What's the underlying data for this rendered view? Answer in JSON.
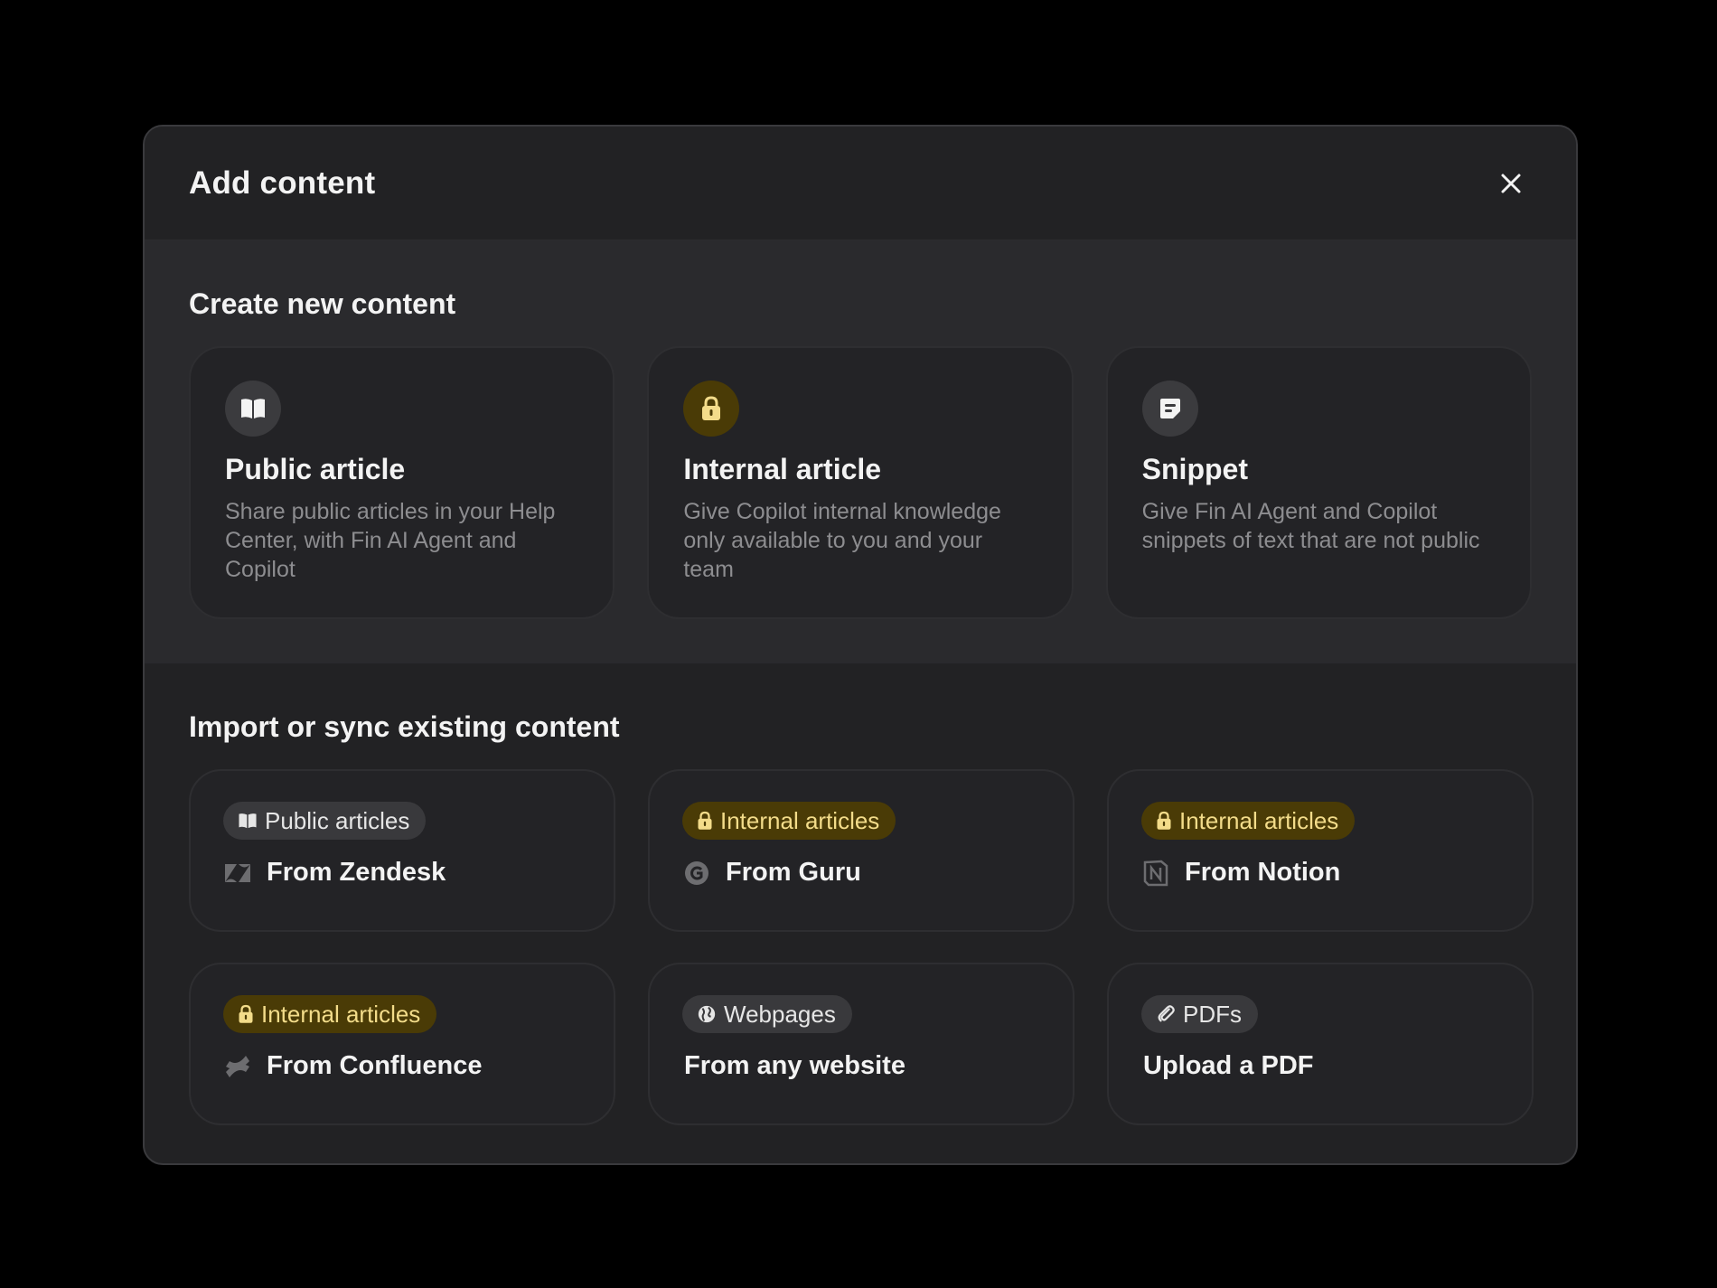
{
  "modal": {
    "title": "Add content",
    "close_icon": "close-icon"
  },
  "create_section": {
    "title": "Create new content",
    "cards": [
      {
        "title": "Public article",
        "description": "Share public articles in your Help Center, with Fin AI Agent and Copilot",
        "icon": "book-icon"
      },
      {
        "title": "Internal article",
        "description": "Give Copilot internal knowledge only available to you and your team",
        "icon": "lock-icon"
      },
      {
        "title": "Snippet",
        "description": "Give Fin AI Agent and Copilot snippets of text that are not public",
        "icon": "snippet-icon"
      }
    ]
  },
  "import_section": {
    "title": "Import or sync existing content",
    "cards": [
      {
        "badge": "Public articles",
        "badge_icon": "book-icon",
        "label": "From Zendesk",
        "source_icon": "zendesk-icon"
      },
      {
        "badge": "Internal articles",
        "badge_icon": "lock-icon",
        "label": "From Guru",
        "source_icon": "guru-icon"
      },
      {
        "badge": "Internal articles",
        "badge_icon": "lock-icon",
        "label": "From Notion",
        "source_icon": "notion-icon"
      },
      {
        "badge": "Internal articles",
        "badge_icon": "lock-icon",
        "label": "From Confluence",
        "source_icon": "confluence-icon"
      },
      {
        "badge": "Webpages",
        "badge_icon": "globe-icon",
        "label": "From any website"
      },
      {
        "badge": "PDFs",
        "badge_icon": "paperclip-icon",
        "label": "Upload a PDF"
      }
    ]
  },
  "colors": {
    "background": "#000000",
    "modal": "#222224",
    "create_section": "#2a2a2d",
    "gold_badge_bg": "#4a3b06",
    "gold_badge_text": "#f3dc8a",
    "muted_text": "#8d8d90"
  }
}
